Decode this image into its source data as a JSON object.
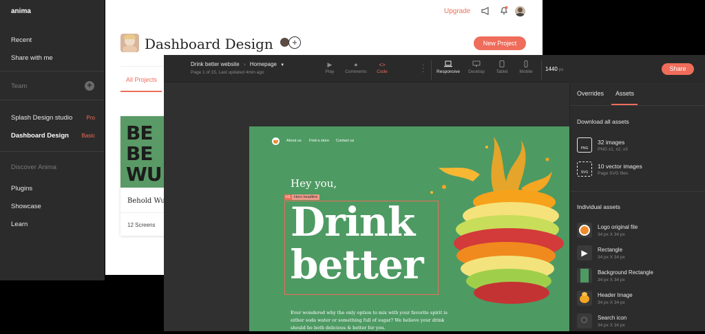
{
  "sidebar": {
    "logo": "anima",
    "items": [
      {
        "label": "Recent"
      },
      {
        "label": "Share with me"
      },
      {
        "label": "Team"
      },
      {
        "label": "Splash Design studio",
        "badge": "Pro"
      },
      {
        "label": "Dashboard Design",
        "badge": "Basic"
      },
      {
        "label": "Discover Anima"
      },
      {
        "label": "Plugins"
      },
      {
        "label": "Showcase"
      },
      {
        "label": "Learn"
      }
    ]
  },
  "dashboard": {
    "upgrade": "Upgrade",
    "title": "Dashboard Design",
    "new_project": "New Project",
    "tab": "All Projects",
    "card": {
      "image_text": [
        "BE",
        "BE",
        "WU"
      ],
      "name": "Behold Wu",
      "screens": "12 Screens"
    }
  },
  "editor": {
    "breadcrumb": {
      "project": "Drink better website",
      "page": "Homepage"
    },
    "subtitle": "Page 1 of 15, Last updated 4min ago",
    "tools": [
      {
        "label": "Play",
        "icon": "play-icon"
      },
      {
        "label": "Comments",
        "icon": "comment-icon"
      },
      {
        "label": "Code",
        "icon": "code-icon"
      }
    ],
    "devices": [
      {
        "label": "Responsive",
        "icon": "laptop-icon"
      },
      {
        "label": "Desktop",
        "icon": "desktop-icon"
      },
      {
        "label": "Tablet",
        "icon": "tablet-icon"
      },
      {
        "label": "Mobile",
        "icon": "mobile-icon"
      }
    ],
    "width": "1440",
    "width_unit": "px",
    "share": "Share"
  },
  "panel": {
    "tabs": [
      "Overrides",
      "Assets"
    ],
    "download_all": "Download all assets",
    "bulk": [
      {
        "name": "32 images",
        "sub": "PNG x1, x2, x3",
        "icon": "png-file-icon"
      },
      {
        "name": "10 vector images",
        "sub": "Page SVG files",
        "icon": "svg-file-icon"
      }
    ],
    "individual_header": "Individual assets",
    "assets": [
      {
        "name": "Logo original file",
        "sub": "34 px X 34 px"
      },
      {
        "name": "Rectangle",
        "sub": "34 px X 34 px"
      },
      {
        "name": "Background Rectangle",
        "sub": "34 px X 34 px"
      },
      {
        "name": "Header Image",
        "sub": "34 px X 34 px"
      },
      {
        "name": "Search icon",
        "sub": "34 px X 34 px"
      }
    ]
  },
  "site": {
    "nav": [
      "About us",
      "Find a store",
      "Contact us"
    ],
    "greeting": "Hey you,",
    "tag_h1": "H1",
    "tag_name": "Hero headline",
    "headline_1": "Drink",
    "headline_2": "better",
    "paragraph": "Ever wondered why the only option to mix with your favorite spirit is either soda water or something full of sugar? We believe your drink should be both delicious & better for you."
  },
  "colors": {
    "accent": "#ef6d5a",
    "site_green": "#4e9a63",
    "dark": "#2b2b2b"
  }
}
